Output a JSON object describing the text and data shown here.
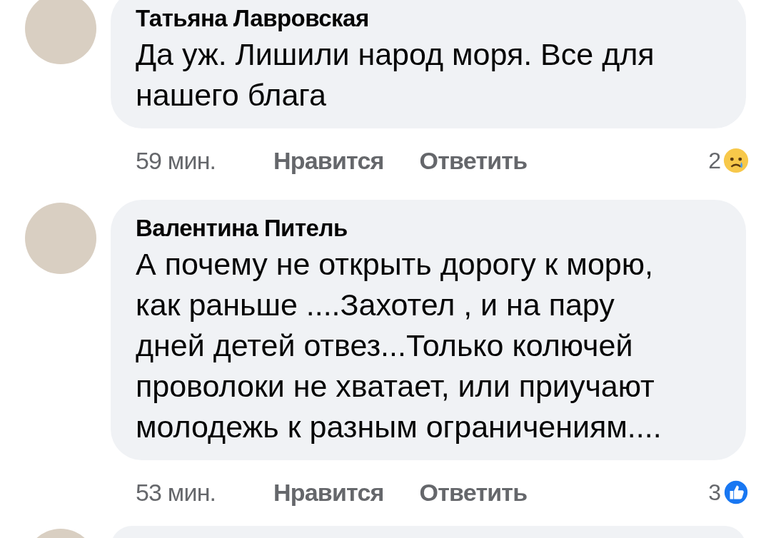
{
  "comments": [
    {
      "author": "Татьяна Лавровская",
      "text": "Да уж. Лишили народ моря. Все для нашего блага",
      "time": "59 мин.",
      "like_label": "Нравится",
      "reply_label": "Ответить",
      "reaction_count": "2",
      "kind": "sad"
    },
    {
      "author": "Валентина Питель",
      "text": "А почему не открыть дорогу к морю, как раньше ....Захотел , и на пару дней детей отвез...Только колючей проволоки не хватает, или приучают молодежь к разным ограничениям....",
      "time": "53 мин.",
      "like_label": "Нравится",
      "reply_label": "Ответить",
      "reaction_count": "3",
      "kind": "like"
    }
  ],
  "next_comment_peek": true
}
